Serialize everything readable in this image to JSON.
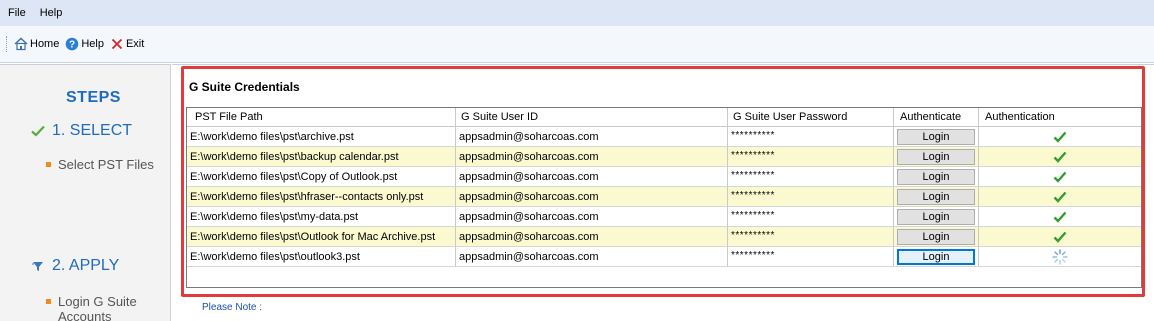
{
  "menu": {
    "file": "File",
    "help": "Help"
  },
  "toolbar": {
    "home": "Home",
    "help": "Help",
    "exit": "Exit"
  },
  "sidebar": {
    "title": "STEPS",
    "step1": "1. SELECT",
    "step1_sub": "Select PST Files",
    "step2": "2. APPLY",
    "step2_sub_line1": "Login G Suite",
    "step2_sub_line2": "Accounts"
  },
  "panel": {
    "title": "G Suite Credentials",
    "columns": [
      "PST File Path",
      "G Suite User ID",
      "G Suite User Password",
      "Authenticate",
      "Authentication"
    ],
    "rows": [
      {
        "path": "E:\\work\\demo files\\pst\\archive.pst",
        "user": "appsadmin@soharcoas.com",
        "password": "**********",
        "button": "Login",
        "status": "authenticated"
      },
      {
        "path": "E:\\work\\demo files\\pst\\backup calendar.pst",
        "user": "appsadmin@soharcoas.com",
        "password": "**********",
        "button": "Login",
        "status": "authenticated"
      },
      {
        "path": "E:\\work\\demo files\\pst\\Copy of Outlook.pst",
        "user": "appsadmin@soharcoas.com",
        "password": "**********",
        "button": "Login",
        "status": "authenticated"
      },
      {
        "path": "E:\\work\\demo files\\pst\\hfraser--contacts only.pst",
        "user": "appsadmin@soharcoas.com",
        "password": "**********",
        "button": "Login",
        "status": "authenticated"
      },
      {
        "path": "E:\\work\\demo files\\pst\\my-data.pst",
        "user": "appsadmin@soharcoas.com",
        "password": "**********",
        "button": "Login",
        "status": "authenticated"
      },
      {
        "path": "E:\\work\\demo files\\pst\\Outlook for Mac Archive.pst",
        "user": "appsadmin@soharcoas.com",
        "password": "**********",
        "button": "Login",
        "status": "authenticated"
      },
      {
        "path": "E:\\work\\demo files\\pst\\outlook3.pst",
        "user": "appsadmin@soharcoas.com",
        "password": "**********",
        "button": "Login",
        "status": "loading"
      }
    ]
  },
  "note": "Please Note :",
  "colors": {
    "accent": "#1f6bbd",
    "frame": "#e33b3b",
    "row_alt": "#fbf9cf",
    "check": "#2ea02e",
    "bullet": "#f08a1c"
  },
  "icons": {
    "home": "home-icon",
    "help": "help-icon",
    "exit": "close-icon",
    "step1": "checkmark-icon",
    "step2": "funnel-icon",
    "auth_ok": "checkmark-icon",
    "auth_loading": "spinner-icon"
  }
}
